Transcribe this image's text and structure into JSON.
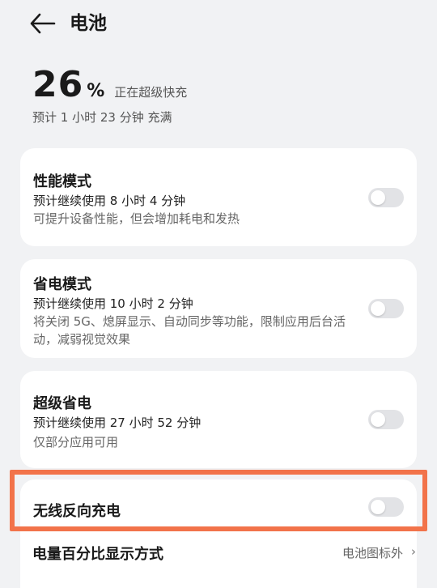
{
  "header": {
    "title": "电池"
  },
  "battery": {
    "percent": "26",
    "percent_sign": "%",
    "status": "正在超级快充",
    "eta": "预计 1 小时 23 分钟 充满"
  },
  "cards": [
    {
      "title": "性能模式",
      "line1": "预计继续使用 8 小时 4 分钟",
      "line2": "可提升设备性能，但会增加耗电和发热",
      "enabled": false
    },
    {
      "title": "省电模式",
      "line1": "预计继续使用 10 小时 2 分钟",
      "line2": "将关闭 5G、熄屏显示、自动同步等功能，限制应用后台活动，减弱视觉效果",
      "enabled": false
    },
    {
      "title": "超级省电",
      "line1": "预计继续使用 27 小时 52 分钟",
      "line2": "仅部分应用可用",
      "enabled": false
    },
    {
      "title": "无线反向充电",
      "enabled": false
    }
  ],
  "display_row": {
    "label": "电量百分比显示方式",
    "value": "电池图标外",
    "chevron": "›"
  },
  "colors": {
    "background": "#f1f2f4",
    "card": "#ffffff",
    "toggle_off": "#e2e3e6",
    "highlight": "#f2734a"
  },
  "icons": {
    "back": "arrow-left-icon",
    "chevron": "chevron-right-icon"
  }
}
